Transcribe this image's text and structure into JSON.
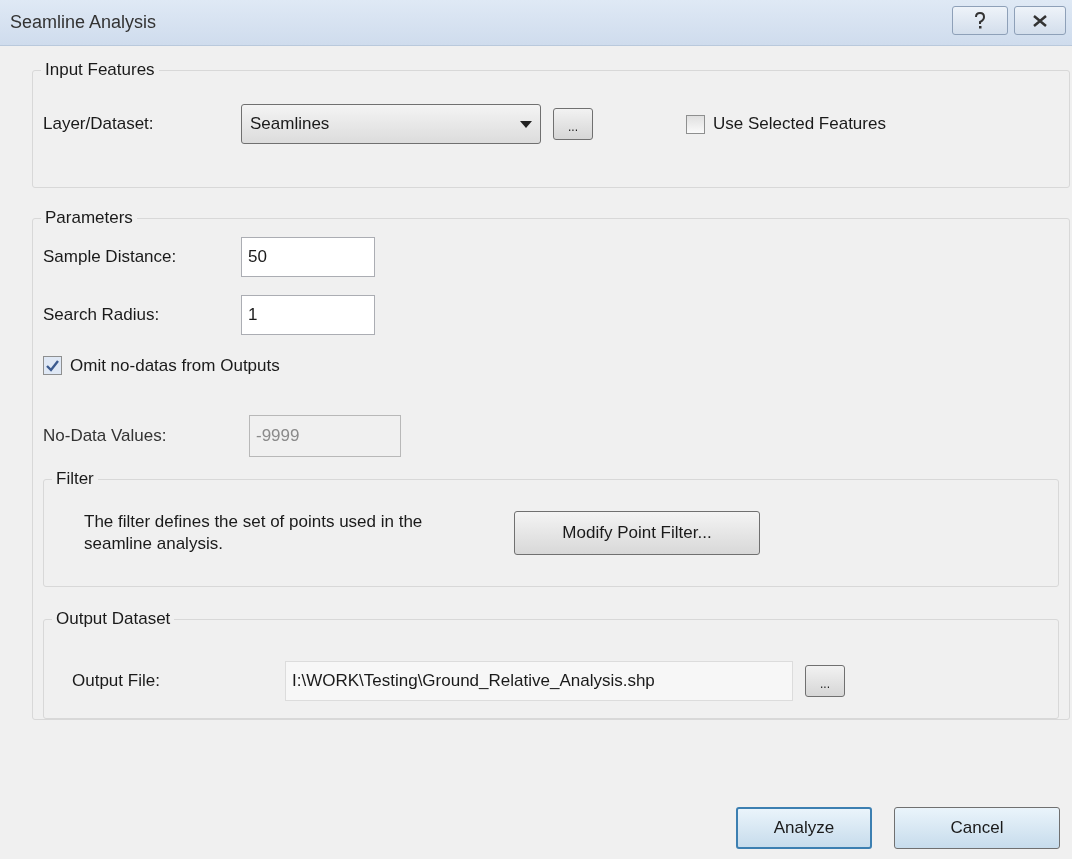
{
  "window": {
    "title": "Seamline Analysis"
  },
  "input_features": {
    "title": "Input Features",
    "layer_label": "Layer/Dataset:",
    "layer_value": "Seamlines",
    "browse_button": "...",
    "use_selected": {
      "label": "Use Selected Features",
      "checked": false
    }
  },
  "parameters": {
    "title": "Parameters",
    "fields": [
      {
        "label": "Sample Distance:",
        "value": "50"
      },
      {
        "label": "Search Radius:",
        "value": "1"
      }
    ],
    "omit_nodata": {
      "label": "Omit no-datas from Outputs",
      "checked": true
    },
    "nodata": {
      "label": "No-Data Values:",
      "value": "-9999",
      "disabled": true
    },
    "filter": {
      "title": "Filter",
      "description": "The filter defines the set of points used in the seamline analysis.",
      "button": "Modify Point Filter..."
    },
    "output": {
      "title": "Output Dataset",
      "label": "Output File:",
      "value": "I:\\WORK\\Testing\\Ground_Relative_Analysis.shp",
      "browse_button": "..."
    }
  },
  "buttons": [
    {
      "label": "Analyze",
      "default": true
    },
    {
      "label": "Cancel",
      "default": false
    }
  ]
}
